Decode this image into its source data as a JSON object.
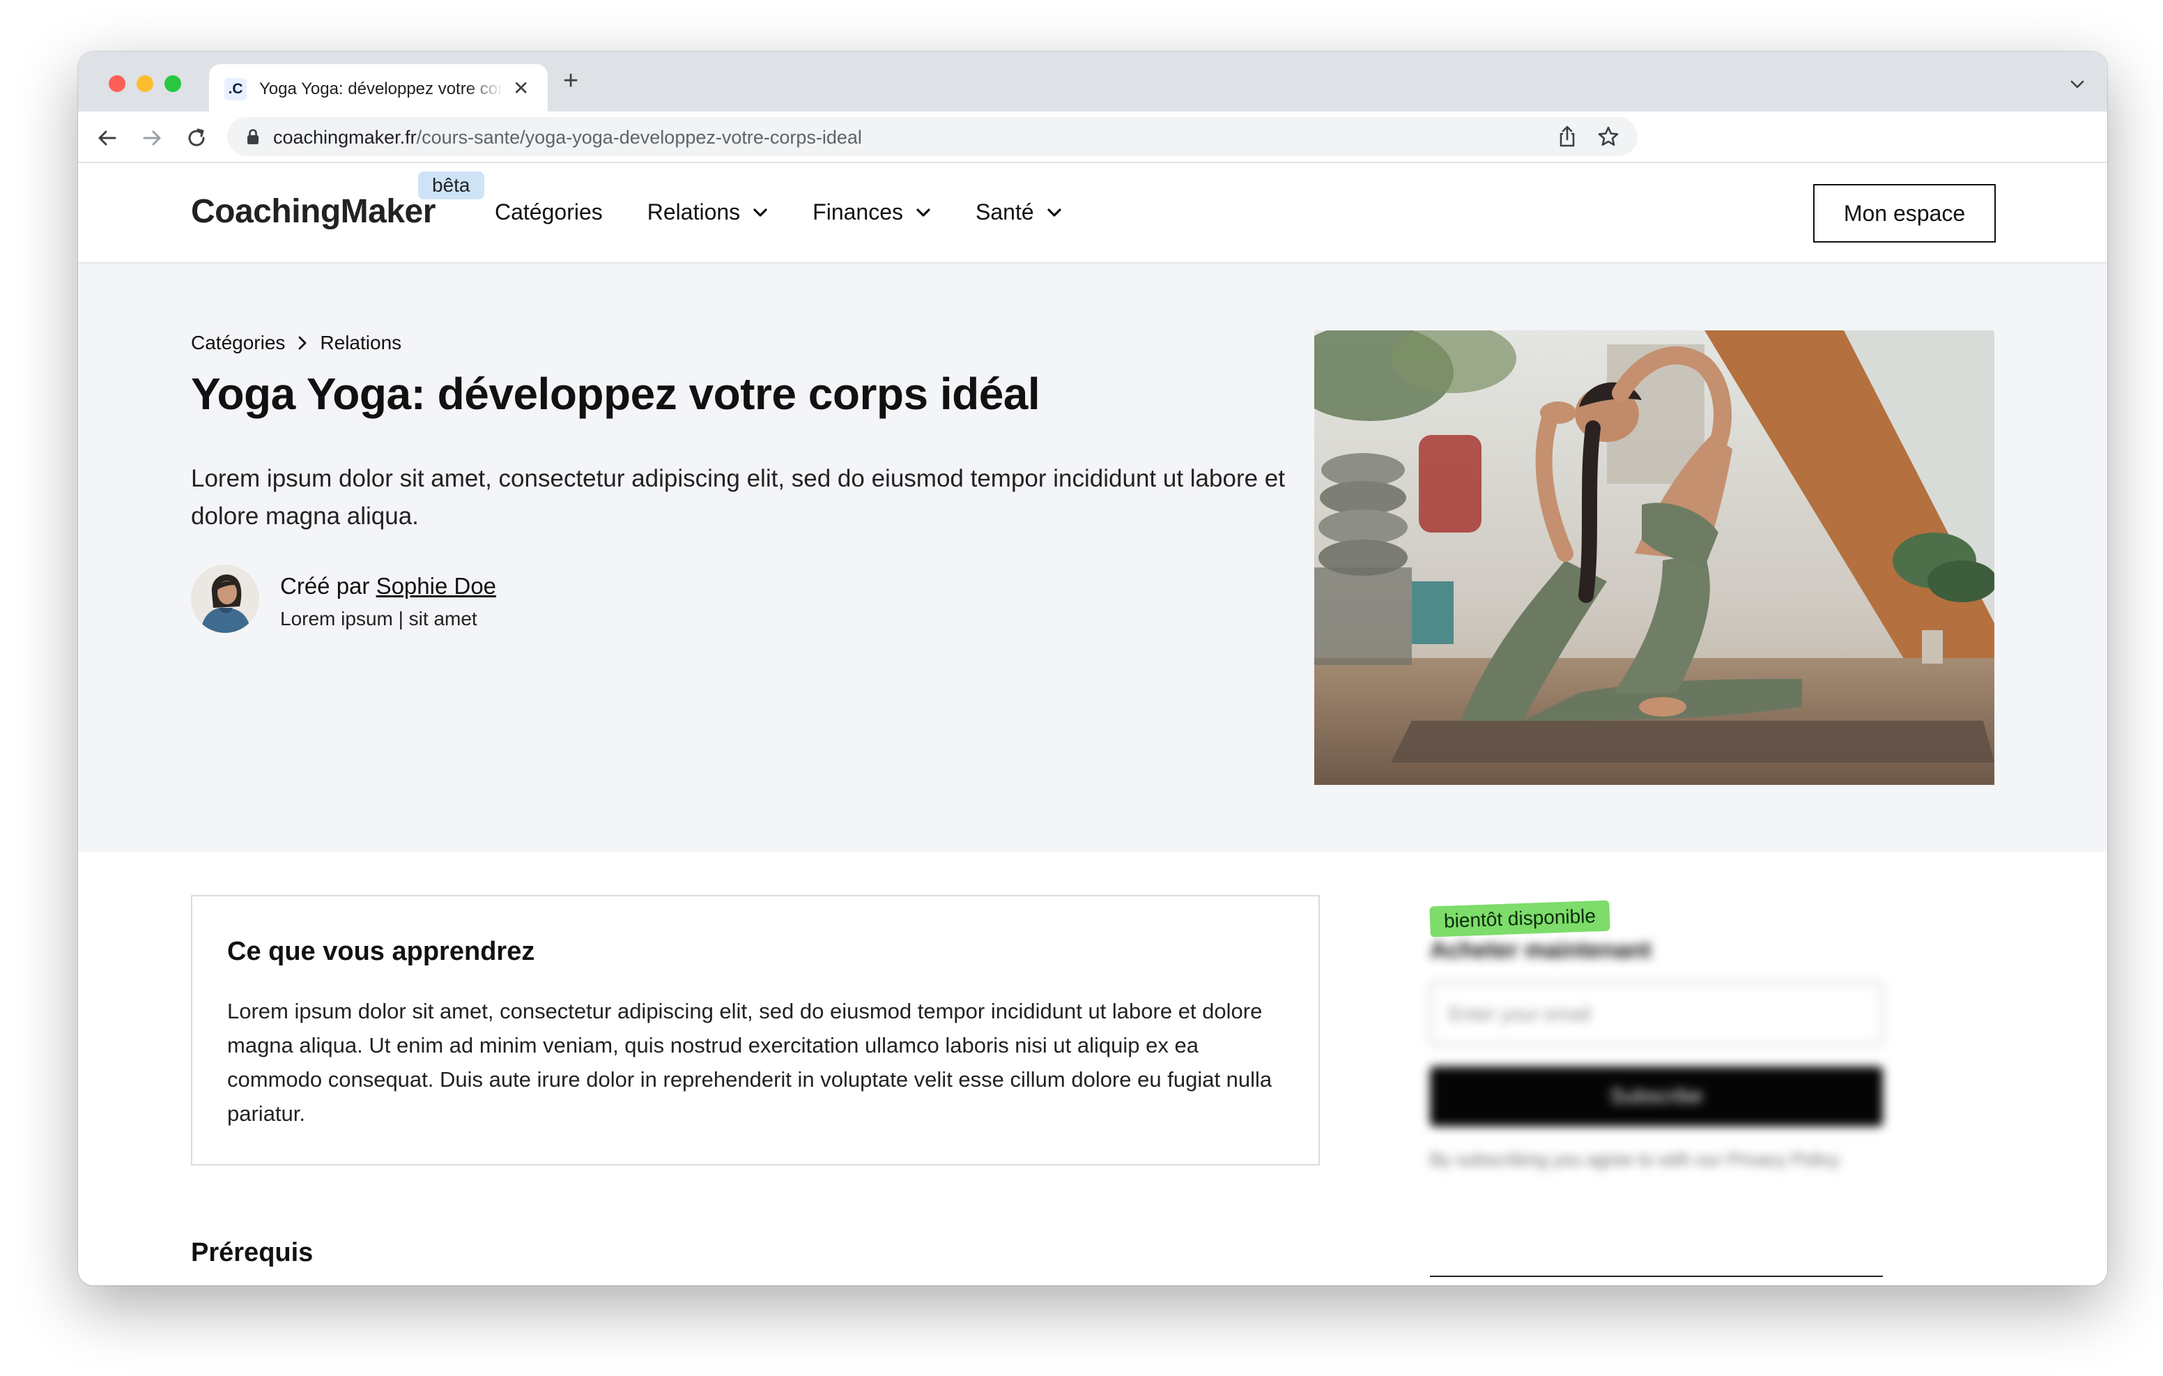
{
  "browser": {
    "tab_title": "Yoga Yoga: développez votre corps idéal",
    "tab_favicon": ".C",
    "url_host": "coachingmaker.fr",
    "url_path": "/cours-sante/yoga-yoga-developpez-votre-corps-ideal"
  },
  "site": {
    "logo": "CoachingMaker",
    "beta_badge": "bêta",
    "nav": [
      {
        "label": "Catégories",
        "has_dropdown": false
      },
      {
        "label": "Relations",
        "has_dropdown": true
      },
      {
        "label": "Finances",
        "has_dropdown": true
      },
      {
        "label": "Santé",
        "has_dropdown": true
      }
    ],
    "account_button": "Mon espace"
  },
  "hero": {
    "breadcrumb": [
      "Catégories",
      "Relations"
    ],
    "title": "Yoga Yoga: développez votre corps idéal",
    "description": "Lorem ipsum dolor sit amet, consectetur adipiscing elit, sed do eiusmod tempor incididunt ut labore et dolore magna aliqua.",
    "author_prefix": "Créé par",
    "author_name": "Sophie Doe",
    "author_sub": "Lorem ipsum | sit amet"
  },
  "learn": {
    "title": "Ce que vous apprendrez",
    "text": "Lorem ipsum dolor sit amet, consectetur adipiscing elit, sed do eiusmod tempor incididunt ut labore et dolore magna aliqua. Ut enim ad minim veniam, quis nostrud exercitation ullamco laboris nisi ut aliquip ex ea commodo consequat. Duis aute irure dolor in reprehenderit in voluptate velit esse cillum dolore eu fugiat nulla pariatur."
  },
  "prereq": {
    "title": "Prérequis"
  },
  "sidebar": {
    "badge": "bientôt disponible",
    "heading": "Acheter maintenant",
    "email_placeholder": "Enter your email",
    "button": "Subscribe",
    "note": "By subscribing you agree to with our Privacy Policy"
  },
  "colors": {
    "hero_bg": "#f4f5f8",
    "beta_badge": "#cfe3f7",
    "soon_badge": "#7ddc6a"
  }
}
